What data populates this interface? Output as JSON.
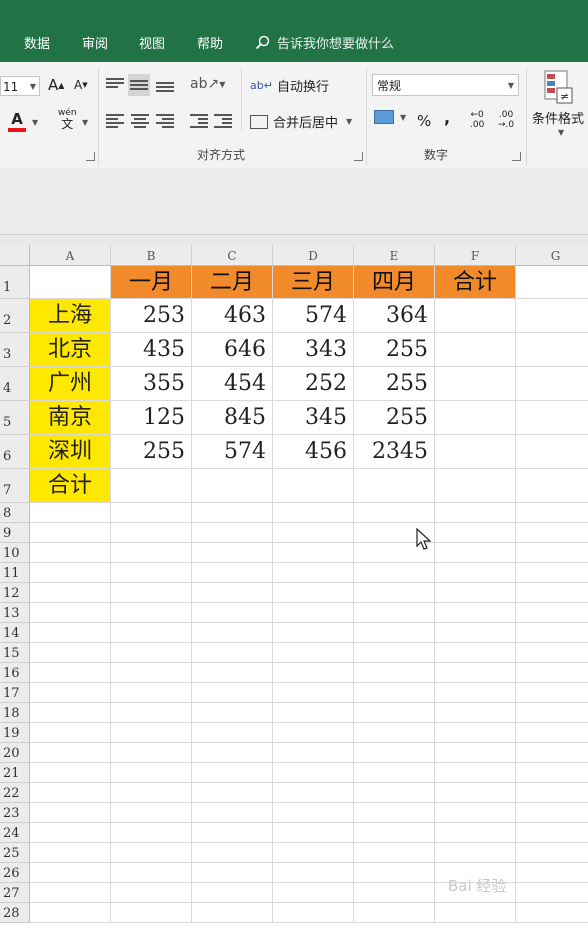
{
  "menu": {
    "tabs": [
      "数据",
      "审阅",
      "视图",
      "帮助"
    ],
    "tell_me": "告诉我你想要做什么"
  },
  "ribbon": {
    "font_size": "11",
    "grow_label": "A",
    "shrink_label": "A",
    "phonetic_top": "wén",
    "phonetic_bottom": "文",
    "font_color_label": "A",
    "wrap_text": "自动换行",
    "merge_center": "合并后居中",
    "alignment_group": "对齐方式",
    "number_format": "常规",
    "percent": "%",
    "comma": ",",
    "number_group": "数字",
    "cond_format": "条件格式",
    "inc_decimal_top": "←0",
    "inc_decimal_bottom": ".00",
    "dec_decimal_top": ".00",
    "dec_decimal_bottom": "→.0"
  },
  "sheet": {
    "columns": [
      "A",
      "B",
      "C",
      "D",
      "E",
      "F",
      "G"
    ],
    "rows": [
      "1",
      "2",
      "3",
      "4",
      "5",
      "6",
      "7",
      "8",
      "9",
      "10",
      "11",
      "12",
      "13",
      "14",
      "15",
      "16",
      "17",
      "18",
      "19",
      "20",
      "21",
      "22",
      "23",
      "24",
      "25",
      "26",
      "27",
      "28"
    ],
    "header_row": [
      "一月",
      "二月",
      "三月",
      "四月",
      "合计"
    ],
    "data": [
      {
        "city": "上海",
        "values": [
          "253",
          "463",
          "574",
          "364"
        ]
      },
      {
        "city": "北京",
        "values": [
          "435",
          "646",
          "343",
          "255"
        ]
      },
      {
        "city": "广州",
        "values": [
          "355",
          "454",
          "252",
          "255"
        ]
      },
      {
        "city": "南京",
        "values": [
          "125",
          "845",
          "345",
          "255"
        ]
      },
      {
        "city": "深圳",
        "values": [
          "255",
          "574",
          "456",
          "2345"
        ]
      }
    ],
    "total_label": "合计"
  },
  "colors": {
    "excel_green": "#217346",
    "header_fill": "#f08a2a",
    "city_fill": "#ffe800"
  },
  "watermark": "Bai 经验"
}
